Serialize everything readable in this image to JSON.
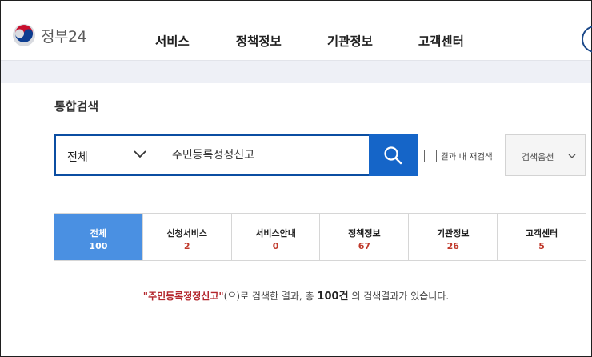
{
  "header": {
    "logo_text": "정부24",
    "nav": [
      "서비스",
      "정책정보",
      "기관정보",
      "고객센터"
    ]
  },
  "page_title": "통합검색",
  "search": {
    "category": "전체",
    "query": "주민등록정정신고",
    "refine_label": "결과 내 재검색",
    "options_label": "검색옵션"
  },
  "tabs": [
    {
      "label": "전체",
      "count": "100"
    },
    {
      "label": "신청서비스",
      "count": "2"
    },
    {
      "label": "서비스안내",
      "count": "0"
    },
    {
      "label": "정책정보",
      "count": "67"
    },
    {
      "label": "기관정보",
      "count": "26"
    },
    {
      "label": "고객센터",
      "count": "5"
    }
  ],
  "summary": {
    "open_quote": "\"",
    "keyword": "주민등록정정신고",
    "close_quote": "\"",
    "mid_text": "(으)로 검색한 결과, 총 ",
    "total": "100",
    "unit": "건",
    "end_text": " 의 검색결과가 있습니다."
  },
  "colors": {
    "brand_blue": "#0b4ea2",
    "search_button": "#1565c8",
    "active_tab": "#4a90e2",
    "count_red": "#c0392b"
  }
}
